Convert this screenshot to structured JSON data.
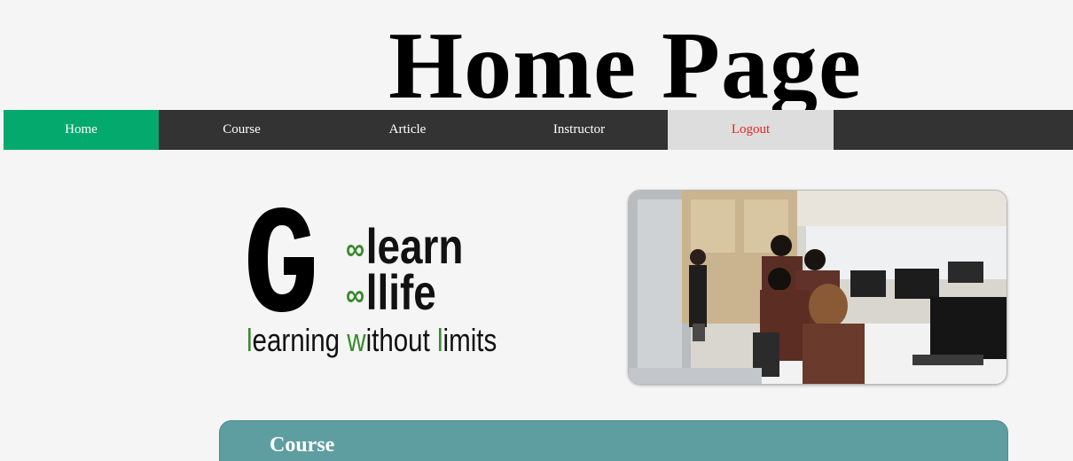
{
  "header": {
    "title": "Home Page"
  },
  "nav": {
    "items": [
      {
        "label": "Home",
        "active": true
      },
      {
        "label": "Course"
      },
      {
        "label": "Article"
      },
      {
        "label": "Instructor"
      },
      {
        "label": "Logout"
      }
    ]
  },
  "logo": {
    "letter": "G",
    "line1_symbol": "∞",
    "line1": "learn",
    "line2_symbol": "∞",
    "line2": "llife",
    "tagline_parts": [
      "l",
      "earning ",
      "w",
      "ithout ",
      "l",
      "imits"
    ]
  },
  "photo": {
    "description_icon": "classroom-photo"
  },
  "course_section": {
    "title": "Course"
  },
  "colors": {
    "nav_bg": "#333333",
    "nav_active": "#04AA6D",
    "logout_bg": "#dddddd",
    "logout_text": "#e8231e",
    "course_panel": "#5f9ea0",
    "logo_green": "#3a8a2e"
  }
}
